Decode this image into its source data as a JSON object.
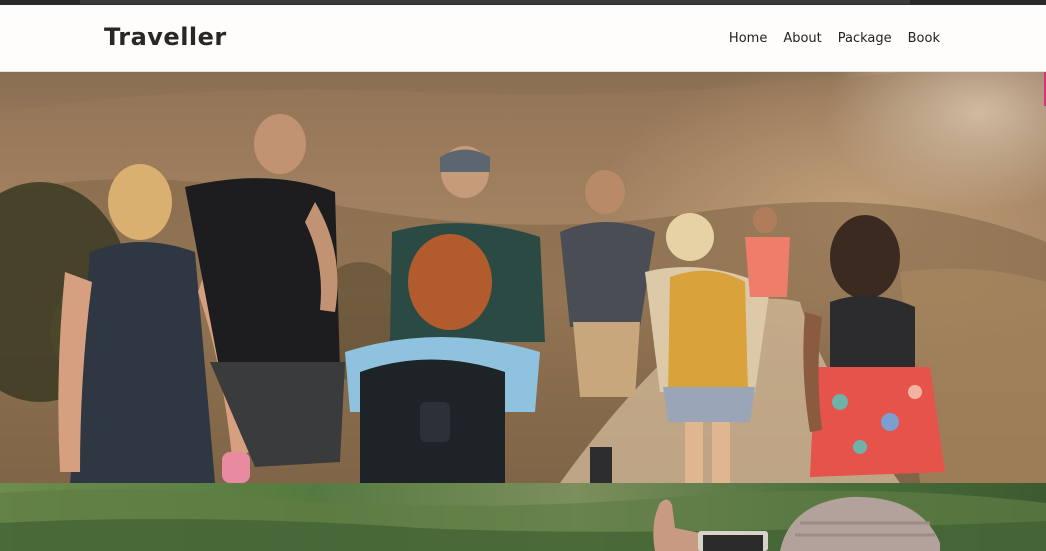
{
  "brand": {
    "name": "Traveller"
  },
  "nav": {
    "items": [
      {
        "label": "Home"
      },
      {
        "label": "About"
      },
      {
        "label": "Package"
      },
      {
        "label": "Book"
      }
    ]
  },
  "colors": {
    "accent": "#d6347d",
    "navbar_bg": "#fffdfb",
    "text": "#2a2623"
  }
}
